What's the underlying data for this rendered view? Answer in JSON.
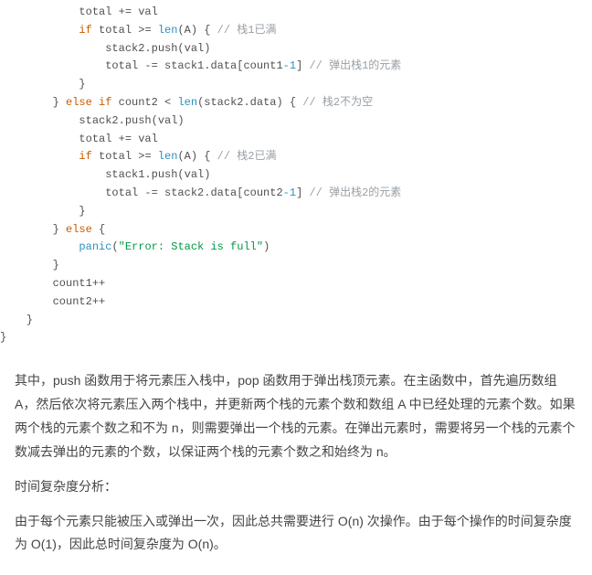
{
  "code": {
    "l1": "            total += val",
    "l2a": "            ",
    "l2b": "if",
    "l2c": " total >= ",
    "l2d": "len",
    "l2e": "(A) { ",
    "l2f": "// 栈1已满",
    "l3": "                stack2.push(val)",
    "l4a": "                total -= stack1.data[count1",
    "l4b": "-1",
    "l4c": "] ",
    "l4d": "// 弹出栈1的元素",
    "l5": "            }",
    "l6a": "        } ",
    "l6b": "else if",
    "l6c": " count2 < ",
    "l6d": "len",
    "l6e": "(stack2.data) { ",
    "l6f": "// 栈2不为空",
    "l7": "            stack2.push(val)",
    "l8": "            total += val",
    "l9a": "            ",
    "l9b": "if",
    "l9c": " total >= ",
    "l9d": "len",
    "l9e": "(A) { ",
    "l9f": "// 栈2已满",
    "l10": "                stack1.push(val)",
    "l11a": "                total -= stack2.data[count2",
    "l11b": "-1",
    "l11c": "] ",
    "l11d": "// 弹出栈2的元素",
    "l12": "            }",
    "l13a": "        } ",
    "l13b": "else",
    "l13c": " {",
    "l14a": "            ",
    "l14b": "panic",
    "l14c": "(",
    "l14d": "\"Error: Stack is full\"",
    "l14e": ")",
    "l15": "        }",
    "l16": "        count1++",
    "l17": "        count2++",
    "l18": "    }",
    "l19": "}"
  },
  "prose": {
    "p1": "其中，push 函数用于将元素压入栈中，pop 函数用于弹出栈顶元素。在主函数中，首先遍历数组 A，然后依次将元素压入两个栈中，并更新两个栈的元素个数和数组 A 中已经处理的元素个数。如果两个栈的元素个数之和不为 n，则需要弹出一个栈的元素。在弹出元素时，需要将另一个栈的元素个数减去弹出的元素的个数，以保证两个栈的元素个数之和始终为 n。",
    "p2": "时间复杂度分析：",
    "p3": "由于每个元素只能被压入或弹出一次，因此总共需要进行 O(n) 次操作。由于每个操作的时间复杂度为 O(1)，因此总时间复杂度为 O(n)。"
  }
}
